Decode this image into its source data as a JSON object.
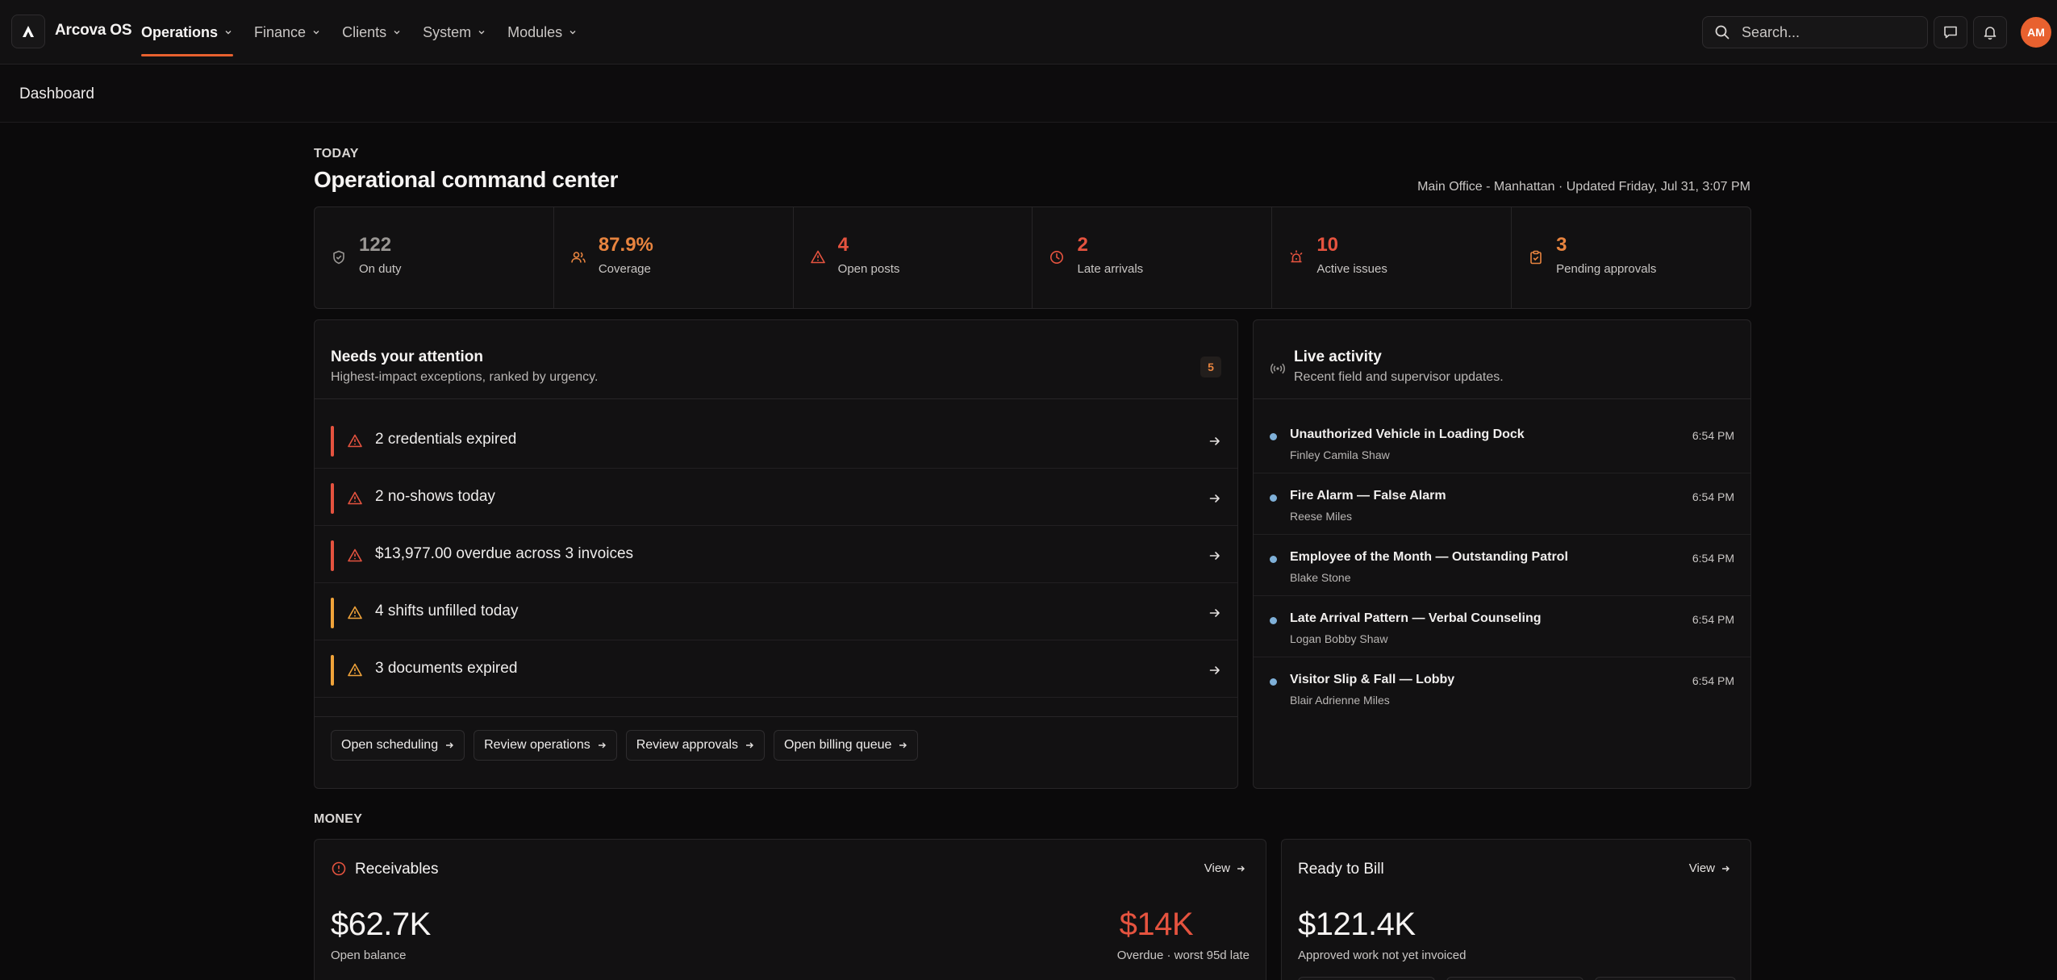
{
  "app": {
    "name": "Arcova OS",
    "logo_icon": "arcova-logo-icon"
  },
  "nav": [
    {
      "label": "Operations",
      "active": true
    },
    {
      "label": "Finance",
      "active": false
    },
    {
      "label": "Clients",
      "active": false
    },
    {
      "label": "System",
      "active": false
    },
    {
      "label": "Modules",
      "active": false
    }
  ],
  "search": {
    "placeholder": "Search..."
  },
  "user": {
    "initials": "AM"
  },
  "breadcrumb": "Dashboard",
  "header": {
    "eyebrow": "TODAY",
    "title": "Operational command center",
    "meta": "Main Office - Manhattan · Updated Friday, Jul 31, 3:07 PM"
  },
  "stats": [
    {
      "value": "122",
      "label": "On duty",
      "icon": "shield-icon",
      "color": "#9a9794"
    },
    {
      "value": "87.9%",
      "label": "Coverage",
      "icon": "users-icon",
      "color": "#e8843f"
    },
    {
      "value": "4",
      "label": "Open posts",
      "icon": "warning-icon",
      "color": "#e5533f"
    },
    {
      "value": "2",
      "label": "Late arrivals",
      "icon": "clock-icon",
      "color": "#e5533f"
    },
    {
      "value": "10",
      "label": "Active issues",
      "icon": "siren-icon",
      "color": "#e5533f"
    },
    {
      "value": "3",
      "label": "Pending approvals",
      "icon": "clipboard-check-icon",
      "color": "#e8843f"
    }
  ],
  "attention": {
    "title": "Needs your attention",
    "subtitle": "Highest-impact exceptions, ranked by urgency.",
    "count": "5",
    "items": [
      {
        "text": "2 credentials expired",
        "severity_color": "#e5533f"
      },
      {
        "text": "2 no-shows today",
        "severity_color": "#e5533f"
      },
      {
        "text": "$13,977.00 overdue across 3 invoices",
        "severity_color": "#e5533f"
      },
      {
        "text": "4 shifts unfilled today",
        "severity_color": "#f0a33a"
      },
      {
        "text": "3 documents expired",
        "severity_color": "#f0a33a"
      }
    ],
    "actions": [
      "Open scheduling",
      "Review operations",
      "Review approvals",
      "Open billing queue"
    ]
  },
  "live": {
    "title": "Live activity",
    "subtitle": "Recent field and supervisor updates.",
    "items": [
      {
        "title": "Unauthorized Vehicle in Loading Dock",
        "who": "Finley Camila Shaw",
        "time": "6:54 PM"
      },
      {
        "title": "Fire Alarm — False Alarm",
        "who": "Reese Miles",
        "time": "6:54 PM"
      },
      {
        "title": "Employee of the Month — Outstanding Patrol",
        "who": "Blake Stone",
        "time": "6:54 PM"
      },
      {
        "title": "Late Arrival Pattern — Verbal Counseling",
        "who": "Logan Bobby Shaw",
        "time": "6:54 PM"
      },
      {
        "title": "Visitor Slip & Fall — Lobby",
        "who": "Blair Adrienne Miles",
        "time": "6:54 PM"
      }
    ]
  },
  "money": {
    "eyebrow": "MONEY",
    "receivables": {
      "title": "Receivables",
      "view": "View",
      "open_value": "$62.7K",
      "open_label": "Open balance",
      "overdue_value": "$14K",
      "overdue_label": "Overdue · worst 95d late"
    },
    "ready": {
      "title": "Ready to Bill",
      "view": "View",
      "value": "$121.4K",
      "label": "Approved work not yet invoiced"
    }
  },
  "colors": {
    "accent": "#e8612f",
    "danger": "#e5533f",
    "warning": "#f0a33a",
    "info": "#7fb0d8"
  }
}
